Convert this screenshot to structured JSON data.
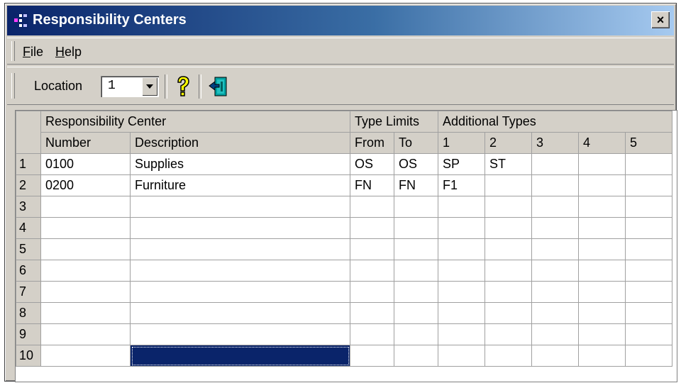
{
  "window": {
    "title": "Responsibility Centers",
    "close_label": "×"
  },
  "menu": [
    {
      "label": "File",
      "accel": "F",
      "rest": "ile"
    },
    {
      "label": "Help",
      "accel": "H",
      "rest": "elp"
    }
  ],
  "toolbar": {
    "location_label": "Location",
    "location_value": "1",
    "icons": [
      "help-question-icon",
      "exit-door-icon"
    ]
  },
  "grid": {
    "group_headers": [
      "Responsibility Center",
      "Type Limits",
      "Additional Types"
    ],
    "columns": [
      "Number",
      "Description",
      "From",
      "To",
      "1",
      "2",
      "3",
      "4",
      "5"
    ],
    "rows": [
      {
        "num": "1",
        "cells": [
          "0100",
          "Supplies",
          "OS",
          "OS",
          "SP",
          "ST",
          "",
          "",
          ""
        ]
      },
      {
        "num": "2",
        "cells": [
          "0200",
          "Furniture",
          "FN",
          "FN",
          "F1",
          "",
          "",
          "",
          ""
        ]
      },
      {
        "num": "3",
        "cells": [
          "",
          "",
          "",
          "",
          "",
          "",
          "",
          "",
          ""
        ]
      },
      {
        "num": "4",
        "cells": [
          "",
          "",
          "",
          "",
          "",
          "",
          "",
          "",
          ""
        ]
      },
      {
        "num": "5",
        "cells": [
          "",
          "",
          "",
          "",
          "",
          "",
          "",
          "",
          ""
        ]
      },
      {
        "num": "6",
        "cells": [
          "",
          "",
          "",
          "",
          "",
          "",
          "",
          "",
          ""
        ]
      },
      {
        "num": "7",
        "cells": [
          "",
          "",
          "",
          "",
          "",
          "",
          "",
          "",
          ""
        ]
      },
      {
        "num": "8",
        "cells": [
          "",
          "",
          "",
          "",
          "",
          "",
          "",
          "",
          ""
        ]
      },
      {
        "num": "9",
        "cells": [
          "",
          "",
          "",
          "",
          "",
          "",
          "",
          "",
          ""
        ]
      },
      {
        "num": "10",
        "cells": [
          "",
          "",
          "",
          "",
          "",
          "",
          "",
          "",
          ""
        ]
      }
    ],
    "selected_cell": "row 10, Description"
  },
  "colors": {
    "title_start": "#0a246a",
    "title_end": "#a6caf0",
    "face": "#d4d0c8",
    "selection": "#0a246a"
  }
}
